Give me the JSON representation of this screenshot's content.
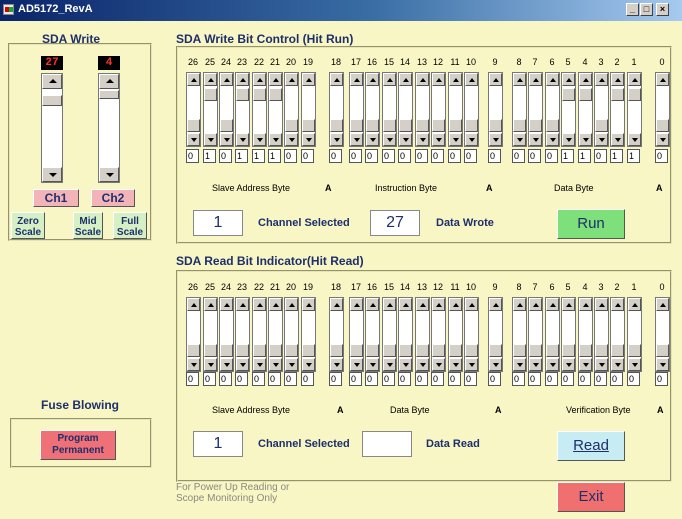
{
  "window": {
    "title": "AD5172_RevA",
    "btn_minimize": "_",
    "btn_maximize": "□",
    "btn_close": "×"
  },
  "left": {
    "sda_write_title": "SDA Write",
    "slider1_value": "27",
    "slider2_value": "4",
    "ch1_label": "Ch1",
    "ch2_label": "Ch2",
    "zero_line1": "Zero",
    "zero_line2": "Scale",
    "mid_line1": "Mid",
    "mid_line2": "Scale",
    "full_line1": "Full",
    "full_line2": "Scale",
    "fuse_title": "Fuse Blowing",
    "program_line1": "Program",
    "program_line2": "Permanent"
  },
  "write": {
    "title": "SDA Write Bit Control (Hit Run)",
    "bit_labels": [
      "26",
      "25",
      "24",
      "23",
      "22",
      "21",
      "20",
      "19",
      "18",
      "17",
      "16",
      "15",
      "14",
      "13",
      "12",
      "11",
      "10",
      "9",
      "8",
      "7",
      "6",
      "5",
      "4",
      "3",
      "2",
      "1",
      "0"
    ],
    "bit_values": [
      "0",
      "1",
      "0",
      "1",
      "1",
      "1",
      "0",
      "0",
      "0",
      "0",
      "0",
      "0",
      "0",
      "0",
      "0",
      "0",
      "0",
      "0",
      "0",
      "0",
      "0",
      "1",
      "1",
      "0",
      "1",
      "1",
      "0"
    ],
    "sec_slave": "Slave Address Byte",
    "sec_instr": "Instruction Byte",
    "sec_data": "Data Byte",
    "ack": "A",
    "channel_value": "1",
    "channel_label": "Channel Selected",
    "data_value": "27",
    "data_label": "Data Wrote",
    "run_label": "Run"
  },
  "read": {
    "title": "SDA Read Bit Indicator(Hit Read)",
    "bit_labels": [
      "26",
      "25",
      "24",
      "23",
      "22",
      "21",
      "20",
      "19",
      "18",
      "17",
      "16",
      "15",
      "14",
      "13",
      "12",
      "11",
      "10",
      "9",
      "8",
      "7",
      "6",
      "5",
      "4",
      "3",
      "2",
      "1",
      "0"
    ],
    "bit_values": [
      "0",
      "0",
      "0",
      "0",
      "0",
      "0",
      "0",
      "0",
      "0",
      "0",
      "0",
      "0",
      "0",
      "0",
      "0",
      "0",
      "0",
      "0",
      "0",
      "0",
      "0",
      "0",
      "0",
      "0",
      "0",
      "0",
      "0"
    ],
    "sec_slave": "Slave Address Byte",
    "sec_data": "Data Byte",
    "sec_verif": "Verification Byte",
    "ack": "A",
    "channel_value": "1",
    "channel_label": "Channel Selected",
    "data_value": "",
    "data_label": "Data Read",
    "read_label": "Read"
  },
  "footer": {
    "note_line1": "For Power Up Reading or",
    "note_line2": "Scope Monitoring Only",
    "exit_label": "Exit"
  },
  "colors": {
    "title_blue": "#1e2f6a",
    "bg": "#f8f6c4",
    "run_green": "#7ee07a",
    "exit_red": "#f07070",
    "read_blue": "#c8ecf4"
  }
}
